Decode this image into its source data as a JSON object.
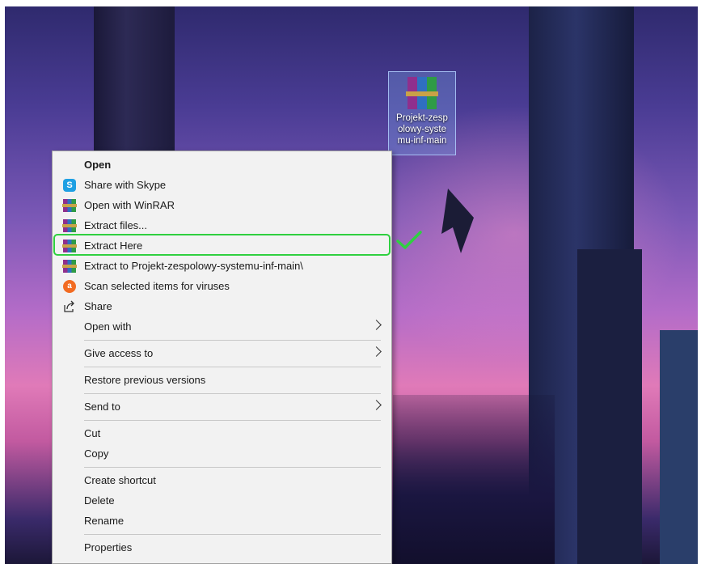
{
  "desktop": {
    "icon": {
      "name": "Projekt-zespolowy-systemu-inf-main",
      "label_lines": [
        "Projekt-zesp",
        "olowy-syste",
        "mu-inf-main"
      ],
      "type": "winrar-archive-icon"
    }
  },
  "context_menu": {
    "items": [
      {
        "label": "Open",
        "icon": "",
        "bold": true
      },
      {
        "label": "Share with Skype",
        "icon": "skype-icon"
      },
      {
        "label": "Open with WinRAR",
        "icon": "winrar-icon"
      },
      {
        "label": "Extract files...",
        "icon": "winrar-icon"
      },
      {
        "label": "Extract Here",
        "icon": "winrar-icon",
        "highlighted": true
      },
      {
        "label": "Extract to Projekt-zespolowy-systemu-inf-main\\",
        "icon": "winrar-icon"
      },
      {
        "label": "Scan selected items for viruses",
        "icon": "avast-icon"
      },
      {
        "label": "Share",
        "icon": "share-icon"
      },
      {
        "label": "Open with",
        "icon": "",
        "submenu": true
      },
      {
        "label": "Give access to",
        "icon": "",
        "submenu": true
      },
      {
        "label": "Restore previous versions",
        "icon": ""
      },
      {
        "label": "Send to",
        "icon": "",
        "submenu": true
      },
      {
        "label": "Cut",
        "icon": ""
      },
      {
        "label": "Copy",
        "icon": ""
      },
      {
        "label": "Create shortcut",
        "icon": ""
      },
      {
        "label": "Delete",
        "icon": ""
      },
      {
        "label": "Rename",
        "icon": ""
      },
      {
        "label": "Properties",
        "icon": ""
      }
    ]
  },
  "annotation": {
    "highlight_color": "#2fd040",
    "checkmark_icon": "checkmark-icon"
  },
  "colors": {
    "menu_background": "#f2f2f2",
    "menu_text": "#1a1a1a"
  }
}
